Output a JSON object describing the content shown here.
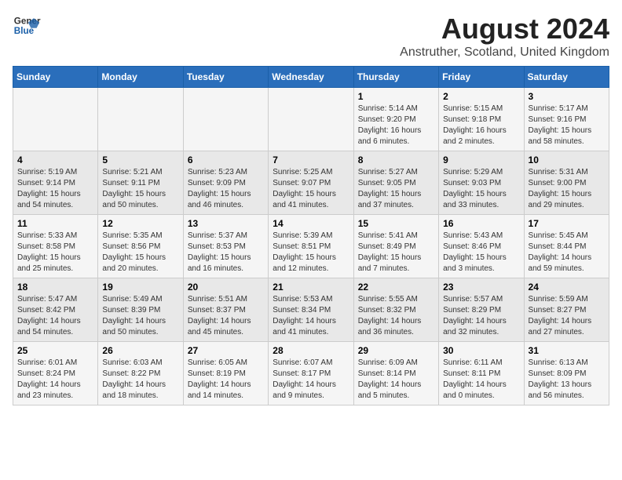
{
  "header": {
    "logo_general": "General",
    "logo_blue": "Blue",
    "title": "August 2024",
    "subtitle": "Anstruther, Scotland, United Kingdom"
  },
  "weekdays": [
    "Sunday",
    "Monday",
    "Tuesday",
    "Wednesday",
    "Thursday",
    "Friday",
    "Saturday"
  ],
  "weeks": [
    [
      {
        "day": "",
        "info": ""
      },
      {
        "day": "",
        "info": ""
      },
      {
        "day": "",
        "info": ""
      },
      {
        "day": "",
        "info": ""
      },
      {
        "day": "1",
        "info": "Sunrise: 5:14 AM\nSunset: 9:20 PM\nDaylight: 16 hours\nand 6 minutes."
      },
      {
        "day": "2",
        "info": "Sunrise: 5:15 AM\nSunset: 9:18 PM\nDaylight: 16 hours\nand 2 minutes."
      },
      {
        "day": "3",
        "info": "Sunrise: 5:17 AM\nSunset: 9:16 PM\nDaylight: 15 hours\nand 58 minutes."
      }
    ],
    [
      {
        "day": "4",
        "info": "Sunrise: 5:19 AM\nSunset: 9:14 PM\nDaylight: 15 hours\nand 54 minutes."
      },
      {
        "day": "5",
        "info": "Sunrise: 5:21 AM\nSunset: 9:11 PM\nDaylight: 15 hours\nand 50 minutes."
      },
      {
        "day": "6",
        "info": "Sunrise: 5:23 AM\nSunset: 9:09 PM\nDaylight: 15 hours\nand 46 minutes."
      },
      {
        "day": "7",
        "info": "Sunrise: 5:25 AM\nSunset: 9:07 PM\nDaylight: 15 hours\nand 41 minutes."
      },
      {
        "day": "8",
        "info": "Sunrise: 5:27 AM\nSunset: 9:05 PM\nDaylight: 15 hours\nand 37 minutes."
      },
      {
        "day": "9",
        "info": "Sunrise: 5:29 AM\nSunset: 9:03 PM\nDaylight: 15 hours\nand 33 minutes."
      },
      {
        "day": "10",
        "info": "Sunrise: 5:31 AM\nSunset: 9:00 PM\nDaylight: 15 hours\nand 29 minutes."
      }
    ],
    [
      {
        "day": "11",
        "info": "Sunrise: 5:33 AM\nSunset: 8:58 PM\nDaylight: 15 hours\nand 25 minutes."
      },
      {
        "day": "12",
        "info": "Sunrise: 5:35 AM\nSunset: 8:56 PM\nDaylight: 15 hours\nand 20 minutes."
      },
      {
        "day": "13",
        "info": "Sunrise: 5:37 AM\nSunset: 8:53 PM\nDaylight: 15 hours\nand 16 minutes."
      },
      {
        "day": "14",
        "info": "Sunrise: 5:39 AM\nSunset: 8:51 PM\nDaylight: 15 hours\nand 12 minutes."
      },
      {
        "day": "15",
        "info": "Sunrise: 5:41 AM\nSunset: 8:49 PM\nDaylight: 15 hours\nand 7 minutes."
      },
      {
        "day": "16",
        "info": "Sunrise: 5:43 AM\nSunset: 8:46 PM\nDaylight: 15 hours\nand 3 minutes."
      },
      {
        "day": "17",
        "info": "Sunrise: 5:45 AM\nSunset: 8:44 PM\nDaylight: 14 hours\nand 59 minutes."
      }
    ],
    [
      {
        "day": "18",
        "info": "Sunrise: 5:47 AM\nSunset: 8:42 PM\nDaylight: 14 hours\nand 54 minutes."
      },
      {
        "day": "19",
        "info": "Sunrise: 5:49 AM\nSunset: 8:39 PM\nDaylight: 14 hours\nand 50 minutes."
      },
      {
        "day": "20",
        "info": "Sunrise: 5:51 AM\nSunset: 8:37 PM\nDaylight: 14 hours\nand 45 minutes."
      },
      {
        "day": "21",
        "info": "Sunrise: 5:53 AM\nSunset: 8:34 PM\nDaylight: 14 hours\nand 41 minutes."
      },
      {
        "day": "22",
        "info": "Sunrise: 5:55 AM\nSunset: 8:32 PM\nDaylight: 14 hours\nand 36 minutes."
      },
      {
        "day": "23",
        "info": "Sunrise: 5:57 AM\nSunset: 8:29 PM\nDaylight: 14 hours\nand 32 minutes."
      },
      {
        "day": "24",
        "info": "Sunrise: 5:59 AM\nSunset: 8:27 PM\nDaylight: 14 hours\nand 27 minutes."
      }
    ],
    [
      {
        "day": "25",
        "info": "Sunrise: 6:01 AM\nSunset: 8:24 PM\nDaylight: 14 hours\nand 23 minutes."
      },
      {
        "day": "26",
        "info": "Sunrise: 6:03 AM\nSunset: 8:22 PM\nDaylight: 14 hours\nand 18 minutes."
      },
      {
        "day": "27",
        "info": "Sunrise: 6:05 AM\nSunset: 8:19 PM\nDaylight: 14 hours\nand 14 minutes."
      },
      {
        "day": "28",
        "info": "Sunrise: 6:07 AM\nSunset: 8:17 PM\nDaylight: 14 hours\nand 9 minutes."
      },
      {
        "day": "29",
        "info": "Sunrise: 6:09 AM\nSunset: 8:14 PM\nDaylight: 14 hours\nand 5 minutes."
      },
      {
        "day": "30",
        "info": "Sunrise: 6:11 AM\nSunset: 8:11 PM\nDaylight: 14 hours\nand 0 minutes."
      },
      {
        "day": "31",
        "info": "Sunrise: 6:13 AM\nSunset: 8:09 PM\nDaylight: 13 hours\nand 56 minutes."
      }
    ]
  ]
}
